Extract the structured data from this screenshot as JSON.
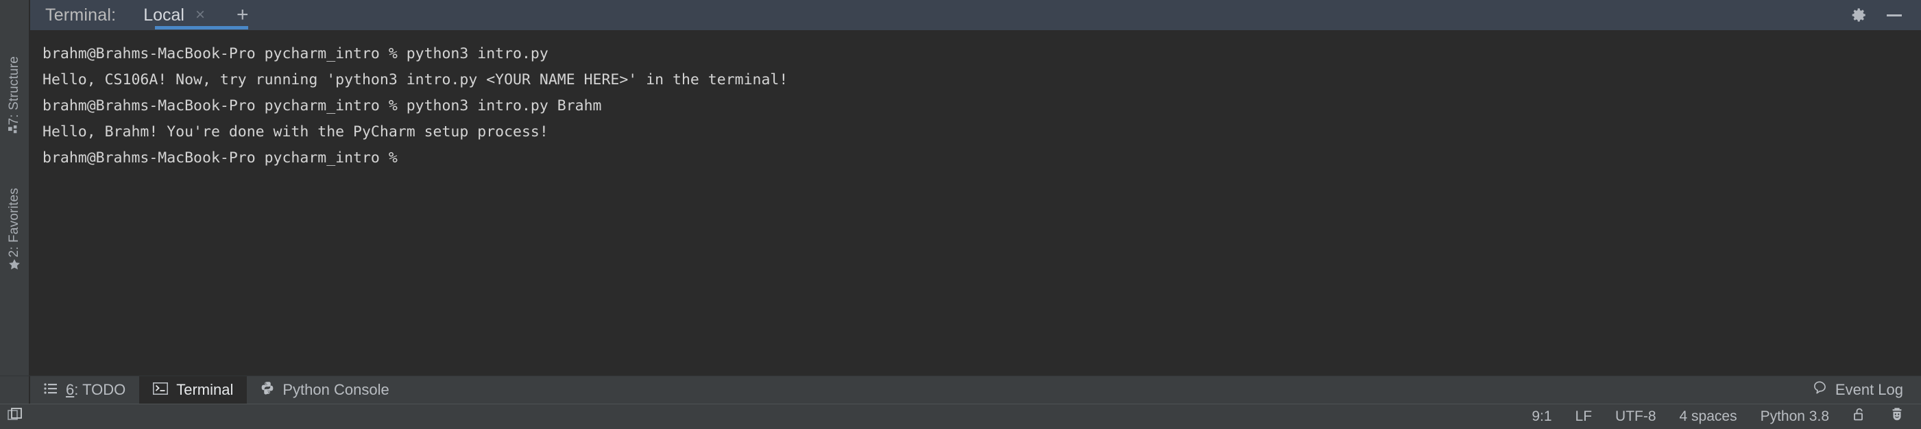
{
  "window": {
    "tool_label": "Terminal:",
    "accent_color": "#4a88c7",
    "terminal_bg": "#2b2b2b",
    "chrome_bg": "#3c3f41",
    "tabbar_bg": "#3c4450",
    "text_color": "#d4d4d4"
  },
  "terminal_tabs": {
    "items": [
      {
        "label": "Local",
        "close": "×",
        "selected": true
      }
    ],
    "add_label": "+"
  },
  "topbar_icons": {
    "settings": "gear-icon",
    "minimize": "minimize-icon"
  },
  "left_rail": {
    "items": [
      {
        "label": "7: Structure",
        "icon": "structure-icon"
      },
      {
        "label": "2: Favorites",
        "icon": "star-icon"
      }
    ]
  },
  "terminal_output": {
    "lines": [
      "brahm@Brahms-MacBook-Pro pycharm_intro % python3 intro.py",
      "Hello, CS106A! Now, try running 'python3 intro.py <YOUR NAME HERE>' in the terminal!",
      "brahm@Brahms-MacBook-Pro pycharm_intro % python3 intro.py Brahm",
      "Hello, Brahm! You're done with the PyCharm setup process!",
      "brahm@Brahms-MacBook-Pro pycharm_intro % "
    ]
  },
  "bottom_bar": {
    "tabs": [
      {
        "label_prefix": "6",
        "label_suffix": ": TODO",
        "icon": "todo-list-icon",
        "selected": false
      },
      {
        "label_prefix": "",
        "label_suffix": "Terminal",
        "icon": "terminal-icon",
        "selected": true
      },
      {
        "label_prefix": "",
        "label_suffix": "Python Console",
        "icon": "python-icon",
        "selected": false
      }
    ],
    "event_log": {
      "label": "Event Log",
      "icon": "balloon-icon"
    }
  },
  "status_bar": {
    "layout_icon": "window-layout-icon",
    "caret_position": "9:1",
    "line_separator": "LF",
    "encoding": "UTF-8",
    "indent": "4 spaces",
    "interpreter": "Python 3.8",
    "lock_icon": "unlocked-padlock-icon",
    "inspector_icon": "hector-inspector-icon"
  }
}
